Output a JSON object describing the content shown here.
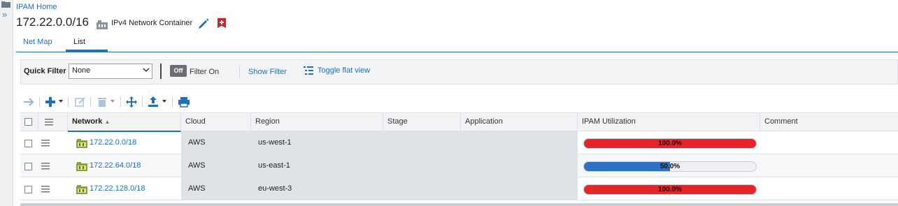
{
  "breadcrumb": "IPAM Home",
  "page_title": "172.22.0.0/16",
  "container_type": "IPv4 Network Container",
  "tabs": [
    {
      "label": "Net Map",
      "active": false
    },
    {
      "label": "List",
      "active": true
    }
  ],
  "filter": {
    "quick_filter_label": "Quick Filter",
    "quick_filter_value": "None",
    "toggle_state": "Off",
    "toggle_label": "Filter On",
    "show_filter": "Show Filter",
    "toggle_flat_view": "Toggle flat view"
  },
  "toolbar_icons": [
    "arrow-right-icon",
    "add-icon",
    "edit-icon",
    "delete-icon",
    "move-icon",
    "export-icon",
    "print-icon"
  ],
  "table": {
    "columns": [
      "Network",
      "Cloud",
      "Region",
      "Stage",
      "Application",
      "IPAM Utilization",
      "Comment"
    ],
    "sort_indicator": "▲",
    "rows": [
      {
        "network": "172.22.0.0/18",
        "cloud": "AWS",
        "region": "us-west-1",
        "stage": "",
        "application": "",
        "utilization": 100.0,
        "utilization_label": "100.0%",
        "comment": ""
      },
      {
        "network": "172.22.64.0/18",
        "cloud": "AWS",
        "region": "us-east-1",
        "stage": "",
        "application": "",
        "utilization": 50.0,
        "utilization_label": "50.0%",
        "comment": ""
      },
      {
        "network": "172.22.128.0/18",
        "cloud": "AWS",
        "region": "eu-west-3",
        "stage": "",
        "application": "",
        "utilization": 100.0,
        "utilization_label": "100.0%",
        "comment": ""
      }
    ]
  },
  "colors": {
    "accent": "#1f6fbf",
    "util_full": "#e8232a",
    "util_partial": "#2f6fc4",
    "bookmark": "#c1272d"
  }
}
